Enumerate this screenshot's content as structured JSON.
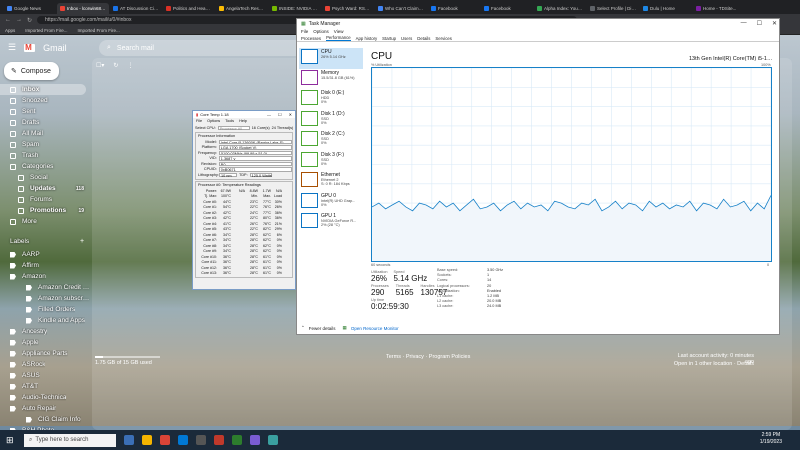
{
  "browser": {
    "tabs": [
      {
        "label": "Google News",
        "color": "#4285f4"
      },
      {
        "label": "Inbox - lcorwin68@...",
        "color": "#ea4335"
      },
      {
        "label": "AT Discussion Circ...",
        "color": "#1a73e8"
      },
      {
        "label": "Politics and Heavy ...",
        "color": "#d93025"
      },
      {
        "label": "AngelaTech Resourc...",
        "color": "#fbbc04"
      },
      {
        "label": "INSIDE: NVIDIA Ge...",
        "color": "#76b900"
      },
      {
        "label": "Psych Ward: RSW S...",
        "color": "#ea4335"
      },
      {
        "label": "Who Can't Claim t...",
        "color": "#4285f4"
      },
      {
        "label": "Facebook",
        "color": "#1877f2"
      },
      {
        "label": "Facebook",
        "color": "#1877f2"
      },
      {
        "label": "Alpha Index: Your ...",
        "color": "#34a853"
      },
      {
        "label": "Select Profile | Dis...",
        "color": "#5f6368"
      },
      {
        "label": "Dulu | Home",
        "color": "#1e88e5"
      },
      {
        "label": "Home - TDSite...",
        "color": "#7b1fa2"
      }
    ],
    "url": "https://mail.google.com/mail/u/0/#inbox",
    "bookmarks": [
      "Apps",
      "Imported From Fire...",
      "Imported From Fire..."
    ]
  },
  "gmail": {
    "logo": "Gmail",
    "search_placeholder": "Search mail",
    "compose": "Compose",
    "nav": [
      {
        "label": "Inbox",
        "count": "",
        "bold": true,
        "selected": true,
        "level": 0
      },
      {
        "label": "Snoozed",
        "count": "",
        "bold": false,
        "selected": false,
        "level": 0
      },
      {
        "label": "Sent",
        "count": "",
        "bold": false,
        "selected": false,
        "level": 0
      },
      {
        "label": "Drafts",
        "count": "",
        "bold": false,
        "selected": false,
        "level": 0
      },
      {
        "label": "All Mail",
        "count": "",
        "bold": false,
        "selected": false,
        "level": 0
      },
      {
        "label": "Spam",
        "count": "",
        "bold": false,
        "selected": false,
        "level": 0
      },
      {
        "label": "Trash",
        "count": "",
        "bold": false,
        "selected": false,
        "level": 0
      },
      {
        "label": "Categories",
        "count": "",
        "bold": false,
        "selected": false,
        "level": 0
      },
      {
        "label": "Social",
        "count": "",
        "bold": false,
        "selected": false,
        "level": 1
      },
      {
        "label": "Updates",
        "count": "118",
        "bold": true,
        "selected": false,
        "level": 1
      },
      {
        "label": "Forums",
        "count": "",
        "bold": false,
        "selected": false,
        "level": 1
      },
      {
        "label": "Promotions",
        "count": "19",
        "bold": true,
        "selected": false,
        "level": 1
      },
      {
        "label": "More",
        "count": "",
        "bold": false,
        "selected": false,
        "level": 0
      }
    ],
    "labels_heading": "Labels",
    "labels": [
      {
        "label": "AARP",
        "level": 0
      },
      {
        "label": "Affirm",
        "level": 0
      },
      {
        "label": "Amazon",
        "level": 0
      },
      {
        "label": "Amazon Credit C...",
        "level": 1
      },
      {
        "label": "Amazon subscrip...",
        "level": 1
      },
      {
        "label": "Filled Orders",
        "level": 1
      },
      {
        "label": "Kindle and Apps",
        "level": 1
      },
      {
        "label": "Ancestry",
        "level": 0
      },
      {
        "label": "Apple",
        "level": 0
      },
      {
        "label": "Appliance Parts",
        "level": 0
      },
      {
        "label": "ASRock",
        "level": 0
      },
      {
        "label": "ASUS",
        "level": 0
      },
      {
        "label": "AT&T",
        "level": 0
      },
      {
        "label": "Audio-Technica",
        "level": 0
      },
      {
        "label": "Auto Repair",
        "level": 0
      },
      {
        "label": "CIG Claim Info",
        "level": 1
      },
      {
        "label": "B&H Photo",
        "level": 0
      }
    ],
    "storage": "1.75 GB of 15 GB used",
    "storage_fraction": 0.117,
    "footer": "Terms · Privacy · Program Policies",
    "activity": "Last account activity: 0 minutes ago",
    "activity2": "Open in 1 other location · Details"
  },
  "coretemp": {
    "title": "Core Temp 1.18",
    "menu": [
      "File",
      "Options",
      "Tools",
      "Help"
    ],
    "select_cpu_label": "Select CPU:",
    "processor_box": "Processor #0",
    "cores_info": "16 Core(s)",
    "threads_info": "24 Thread(s)",
    "proc_info_label": "Processor Information",
    "rows": [
      {
        "k": "Model:",
        "v": "Intel Core i5 13600K (Raptor Lake-S)"
      },
      {
        "k": "Platform:",
        "v": "LGA 1700 (Socket V)"
      },
      {
        "k": "Frequency:",
        "v": "5100.03MHz (99.99 x 51.0)"
      },
      {
        "k": "VID:",
        "v": "1.3687 v"
      },
      {
        "k": "Revision:",
        "v": "B0"
      },
      {
        "k": "CPUID:",
        "v": "0xB0671"
      }
    ],
    "modulation_label": "Modulation:",
    "lithography_label": "Lithography:",
    "lithography": "10 nm",
    "tdp_label": "TDP:",
    "tdp": "125.0 Watts",
    "readings_label": "Processor #0: Temperature Readings",
    "power_row": [
      "Power:",
      "67.9W",
      "N/A",
      "8.8W",
      "1.7W",
      "N/A"
    ],
    "tjmax_row": [
      "Tj. Max:",
      "100°C",
      "",
      "Min.",
      "Max.",
      "Load"
    ],
    "cores": [
      [
        "Core #0:",
        "44°C",
        "",
        "23°C",
        "77°C",
        "30%"
      ],
      [
        "Core #1:",
        "54°C",
        "",
        "22°C",
        "76°C",
        "26%"
      ],
      [
        "Core #2:",
        "42°C",
        "",
        "24°C",
        "77°C",
        "36%"
      ],
      [
        "Core #3:",
        "42°C",
        "",
        "22°C",
        "80°C",
        "36%"
      ],
      [
        "Core #4:",
        "41°C",
        "",
        "26°C",
        "76°C",
        "21%"
      ],
      [
        "Core #5:",
        "43°C",
        "",
        "22°C",
        "82°C",
        "29%"
      ],
      [
        "Core #6:",
        "34°C",
        "",
        "28°C",
        "62°C",
        "6%"
      ],
      [
        "Core #7:",
        "34°C",
        "",
        "28°C",
        "62°C",
        "0%"
      ],
      [
        "Core #8:",
        "34°C",
        "",
        "28°C",
        "62°C",
        "0%"
      ],
      [
        "Core #9:",
        "34°C",
        "",
        "28°C",
        "62°C",
        "0%"
      ],
      [
        "Core #10:",
        "36°C",
        "",
        "28°C",
        "61°C",
        "0%"
      ],
      [
        "Core #11:",
        "36°C",
        "",
        "28°C",
        "61°C",
        "0%"
      ],
      [
        "Core #12:",
        "36°C",
        "",
        "28°C",
        "61°C",
        "0%"
      ],
      [
        "Core #13:",
        "36°C",
        "",
        "28°C",
        "61°C",
        "0%"
      ]
    ]
  },
  "taskmanager": {
    "title": "Task Manager",
    "menu": [
      "File",
      "Options",
      "View"
    ],
    "tabs": [
      "Processes",
      "Performance",
      "App history",
      "Startup",
      "Users",
      "Details",
      "Services"
    ],
    "active_tab": "Performance",
    "side": [
      {
        "name": "CPU",
        "sub1": "26% 5.14 GHz",
        "sub2": "",
        "color": "#0b74c4"
      },
      {
        "name": "Memory",
        "sub1": "15.5/31.8 GB (61%)",
        "sub2": "",
        "color": "#8e2b9e"
      },
      {
        "name": "Disk 0 (E:)",
        "sub1": "HDD",
        "sub2": "0%",
        "color": "#4ca732"
      },
      {
        "name": "Disk 1 (D:)",
        "sub1": "SSD",
        "sub2": "0%",
        "color": "#4ca732"
      },
      {
        "name": "Disk 2 (C:)",
        "sub1": "SSD",
        "sub2": "0%",
        "color": "#4ca732"
      },
      {
        "name": "Disk 3 (F:)",
        "sub1": "SSD",
        "sub2": "0%",
        "color": "#4ca732"
      },
      {
        "name": "Ethernet",
        "sub1": "Ethernet 2",
        "sub2": "S: 0 R: 184 Kbps",
        "color": "#a74f01"
      },
      {
        "name": "GPU 0",
        "sub1": "Intel(R) UHD Grap...",
        "sub2": "0%",
        "color": "#0b74c4"
      },
      {
        "name": "GPU 1",
        "sub1": "NVIDIA GeForce R...",
        "sub2": "2% (28 °C)",
        "color": "#0b74c4"
      }
    ],
    "cpu_title": "CPU",
    "cpu_model": "13th Gen Intel(R) Core(TM) i5-13600K",
    "util_label": "% Utilization",
    "max_label": "100%",
    "seconds_label": "60 seconds",
    "zero_label": "0",
    "stats": [
      {
        "k": "Utilization",
        "v": "26%"
      },
      {
        "k": "Speed",
        "v": "5.14 GHz"
      },
      {
        "k": "Processes",
        "v": "290"
      },
      {
        "k": "Threads",
        "v": "5165"
      },
      {
        "k": "Handles",
        "v": "130757"
      },
      {
        "k": "Up time",
        "v": "0:02:59:30"
      }
    ],
    "specs": [
      {
        "k": "Base speed:",
        "v": "3.50 GHz"
      },
      {
        "k": "Sockets:",
        "v": "1"
      },
      {
        "k": "Cores:",
        "v": "14"
      },
      {
        "k": "Logical processors:",
        "v": "20"
      },
      {
        "k": "Virtualization:",
        "v": "Enabled"
      },
      {
        "k": "L1 cache:",
        "v": "1.2 MB"
      },
      {
        "k": "L2 cache:",
        "v": "20.0 MB"
      },
      {
        "k": "L3 cache:",
        "v": "24.0 MB"
      }
    ],
    "fewer_details": "Fewer details",
    "open_monitor": "Open Resource Monitor",
    "graph_values": [
      28,
      30,
      27,
      29,
      31,
      28,
      26,
      30,
      29,
      27,
      31,
      28,
      30,
      26,
      29,
      32,
      27,
      28,
      30,
      26,
      29,
      31,
      27,
      30,
      28,
      29,
      26,
      31,
      30,
      28,
      27,
      30,
      29,
      32,
      26,
      28,
      31,
      27,
      30,
      29,
      26,
      31,
      28,
      30,
      27,
      29,
      28,
      31,
      26,
      30,
      29,
      27,
      32,
      28,
      29,
      31,
      26,
      30,
      27,
      34
    ]
  },
  "taskbar": {
    "search": "Type here to search",
    "time": "2:59 PM",
    "date": "1/19/2023"
  }
}
